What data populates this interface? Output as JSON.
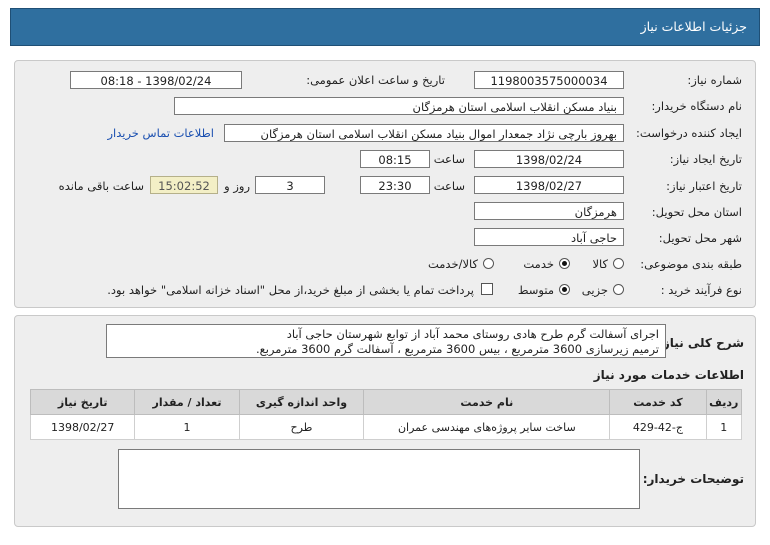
{
  "header": {
    "title": "جزئیات اطلاعات نیاز"
  },
  "form": {
    "need_number_label": "شماره نیاز:",
    "need_number": "1198003575000034",
    "announce_label": "تاریخ و ساعت اعلان عمومی:",
    "announce_value": "1398/02/24 - 08:18",
    "buyer_org_label": "نام دستگاه خریدار:",
    "buyer_org": "بنیاد مسکن انقلاب اسلامی استان هرمزگان",
    "requester_label": "ایجاد کننده درخواست:",
    "requester": "بهروز  بارچی نژاد جمعدار اموال بنیاد مسکن انقلاب اسلامی استان هرمزگان",
    "contact_link": "اطلاعات تماس خریدار",
    "created_label": "تاریخ ایجاد نیاز:",
    "created_date": "1398/02/24",
    "time_label": "ساعت",
    "created_time": "08:15",
    "validity_label": "تاریخ اعتبار نیاز:",
    "validity_date": "1398/02/27",
    "validity_time": "23:30",
    "days_count": "3",
    "days_label": "روز و",
    "remaining_time": "15:02:52",
    "remaining_label": "ساعت باقی مانده",
    "province_label": "استان محل تحویل:",
    "province": "هرمزگان",
    "city_label": "شهر محل تحویل:",
    "city": "حاجی آباد",
    "category_label": "طبقه بندی موضوعی:",
    "category_options": [
      "کالا",
      "خدمت",
      "کالا/خدمت"
    ],
    "category_selected": "خدمت",
    "process_label": "نوع فرآیند خرید :",
    "process_options": [
      "جزیی",
      "متوسط"
    ],
    "process_selected": "متوسط",
    "payment_note": "پرداخت تمام یا بخشی از مبلغ خرید،از محل \"اسناد خزانه اسلامی\" خواهد بود."
  },
  "summary": {
    "label": "شرح کلی نیاز:",
    "line1": "اجرای آسفالت گرم طرح هادی روستای محمد آباد از توابع شهرستان حاجی آباد",
    "line2": "ترمیم زیرسازی 3600 مترمربع  ، بیس 3600 مترمربع ، آسفالت گرم  3600 مترمربع."
  },
  "services": {
    "title": "اطلاعات خدمات مورد نیاز",
    "headers": [
      "ردیف",
      "کد خدمت",
      "نام خدمت",
      "واحد اندازه گیری",
      "تعداد / مقدار",
      "تاریخ نیاز"
    ],
    "rows": [
      [
        "1",
        "ج-42-429",
        "ساخت سایر پروژه‌های مهندسی عمران",
        "طرح",
        "1",
        "1398/02/27"
      ]
    ]
  },
  "buyer_notes": {
    "label": "توضیحات خریدار:",
    "value": ""
  }
}
